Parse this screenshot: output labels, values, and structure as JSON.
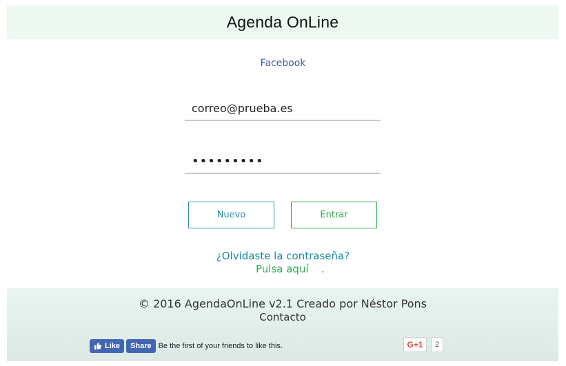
{
  "header": {
    "title": "Agenda OnLine"
  },
  "login": {
    "facebook_link": "Facebook",
    "email_value": "correo@prueba.es",
    "password_value": "•••••••••",
    "new_button": "Nuevo",
    "enter_button": "Entrar",
    "forgot_text": "¿Olvidaste la contraseña?",
    "click_here": "Pulsa aquí",
    "click_here_suffix": "."
  },
  "footer": {
    "copyright": "© 2016  AgendaOnLine v2.1  Creado por Néstor Pons",
    "contact": "Contacto",
    "fb_like_label": "Like",
    "fb_share_label": "Share",
    "fb_social_text": "Be the first of your friends to like this.",
    "gplus_label": "G+1",
    "gplus_count": "2"
  },
  "colors": {
    "header_bg": "#edf8f1",
    "teal": "#2c8fa0",
    "green": "#2ba84a",
    "facebook_blue": "#4267b2",
    "gplus_red": "#dd4b39"
  }
}
